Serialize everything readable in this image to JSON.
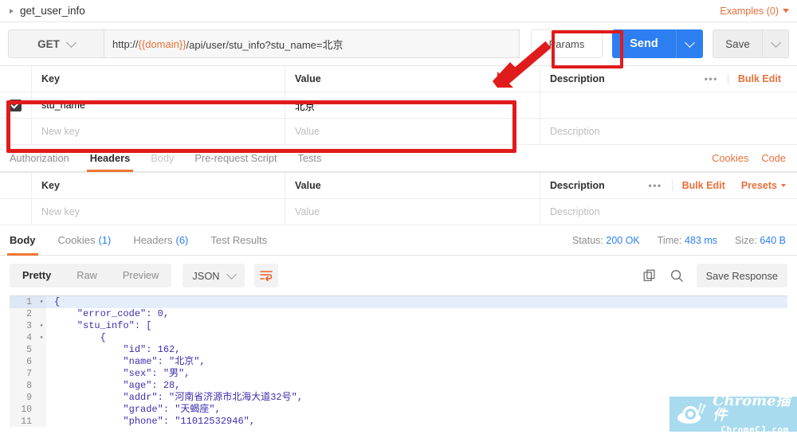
{
  "request": {
    "name": "get_user_info",
    "examples_label": "Examples (0)",
    "method": "GET",
    "url_prefix": "http://",
    "url_variable": "{{domain}}",
    "url_suffix": "/api/user/stu_info?stu_name=北京",
    "params_button": "Params",
    "send_button": "Send",
    "save_button": "Save"
  },
  "params_table": {
    "columns": {
      "key": "Key",
      "value": "Value",
      "description": "Description"
    },
    "dots": "•••",
    "bulk_edit": "Bulk Edit",
    "rows": [
      {
        "checked": true,
        "key": "stu_name",
        "value": "北京",
        "description": ""
      }
    ],
    "placeholders": {
      "key": "New key",
      "value": "Value",
      "description": "Description"
    }
  },
  "request_tabs": {
    "items": [
      {
        "label": "Authorization",
        "state": "normal"
      },
      {
        "label": "Headers",
        "state": "active"
      },
      {
        "label": "Body",
        "state": "muted"
      },
      {
        "label": "Pre-request Script",
        "state": "normal"
      },
      {
        "label": "Tests",
        "state": "normal"
      }
    ],
    "links": [
      "Cookies",
      "Code"
    ]
  },
  "headers_table": {
    "columns": {
      "key": "Key",
      "value": "Value",
      "description": "Description"
    },
    "dots": "•••",
    "bulk_edit": "Bulk Edit",
    "presets": "Presets",
    "placeholders": {
      "key": "New key",
      "value": "Value",
      "description": "Description"
    }
  },
  "response": {
    "tabs": [
      {
        "label": "Body",
        "count": "",
        "active": true
      },
      {
        "label": "Cookies",
        "count": "(1)",
        "active": false
      },
      {
        "label": "Headers",
        "count": "(6)",
        "active": false
      },
      {
        "label": "Test Results",
        "count": "",
        "active": false
      }
    ],
    "meta": {
      "status_label": "Status:",
      "status_value": "200 OK",
      "time_label": "Time:",
      "time_value": "483 ms",
      "size_label": "Size:",
      "size_value": "640 B"
    },
    "view_modes": [
      "Pretty",
      "Raw",
      "Preview"
    ],
    "active_view": "Pretty",
    "format": "JSON",
    "save_response": "Save Response",
    "body_lines": [
      {
        "n": "1",
        "fold": "▾",
        "text": "{",
        "highlight": true
      },
      {
        "n": "2",
        "fold": "",
        "text": "    \"error_code\": 0,"
      },
      {
        "n": "3",
        "fold": "▾",
        "text": "    \"stu_info\": ["
      },
      {
        "n": "4",
        "fold": "▾",
        "text": "        {"
      },
      {
        "n": "5",
        "fold": "",
        "text": "            \"id\": 162,"
      },
      {
        "n": "6",
        "fold": "",
        "text": "            \"name\": \"北京\","
      },
      {
        "n": "7",
        "fold": "",
        "text": "            \"sex\": \"男\","
      },
      {
        "n": "8",
        "fold": "",
        "text": "            \"age\": 28,"
      },
      {
        "n": "9",
        "fold": "",
        "text": "            \"addr\": \"河南省济源市北海大道32号\","
      },
      {
        "n": "10",
        "fold": "",
        "text": "            \"grade\": \"天蝎座\","
      },
      {
        "n": "11",
        "fold": "",
        "text": "            \"phone\": \"11012532946\","
      }
    ]
  },
  "watermark": {
    "line1": "Chrome插件",
    "line2": "ChromeCJ.com"
  },
  "colors": {
    "accent": "#ef7734",
    "primary": "#2d7ff1",
    "annotation": "#e01b1b"
  }
}
